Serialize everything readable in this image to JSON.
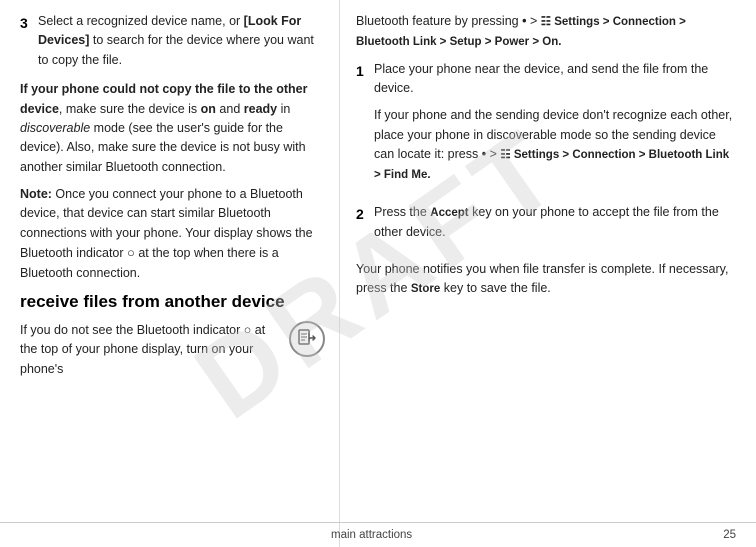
{
  "watermark": "DRAFT",
  "footer": {
    "left": "",
    "center": "main attractions",
    "right": "25"
  },
  "left_col": {
    "step3": {
      "number": "3",
      "text_parts": [
        "Select a recognized device name, or ",
        "[Look For Devices]",
        " to search for the device where you want to copy the file."
      ]
    },
    "warning_heading": "If your phone could not copy the file to the other device",
    "warning_body": ", make sure the device is on and ready in discoverable mode (see the user's guide for the device). Also, make sure the device is not busy with another similar Bluetooth connection.",
    "note_label": "Note:",
    "note_body": " Once you connect your phone to a Bluetooth device, that device can start similar Bluetooth connections with your phone. Your display shows the Bluetooth indicator",
    "note_body2": " at the top when there is a Bluetooth connection.",
    "section_heading": "receive files from another device",
    "section_intro1": "If you do not see the Bluetooth indicator",
    "section_intro2": " at the top of your phone display, turn on your phone's"
  },
  "right_col": {
    "bluetooth_feature_intro": "Bluetooth feature by pressing",
    "menu_path1": "Settings > Connection > Bluetooth Link > Setup > Power > On.",
    "step1": {
      "number": "1",
      "text": "Place your phone near the device, and send the file from the device.",
      "sub_text": "If your phone and the sending device don't recognize each other, place your phone in discoverable mode so the sending device can locate it: press",
      "menu_path": "Settings > Connection > Bluetooth Link > Find Me."
    },
    "step2": {
      "number": "2",
      "text_pre": "Press the ",
      "accept_key": "Accept",
      "text_mid": " key on your phone to accept the file from the other device."
    },
    "conclusion": "Your phone notifies you when file transfer is complete. If necessary, press the ",
    "store_key": "Store",
    "conclusion2": " key to save the file."
  }
}
